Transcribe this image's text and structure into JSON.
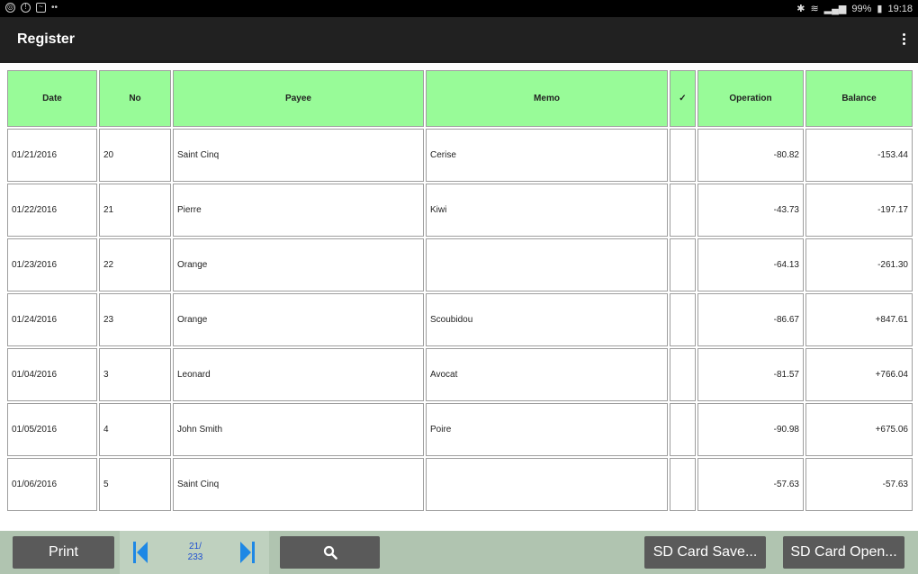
{
  "statusbar": {
    "battery": "99%",
    "time": "19:18"
  },
  "appbar": {
    "title": "Register"
  },
  "table": {
    "headers": [
      "Date",
      "No",
      "Payee",
      "Memo",
      "✓",
      "Operation",
      "Balance"
    ],
    "rows": [
      [
        "01/21/2016",
        "20",
        "Saint Cinq",
        "Cerise",
        "",
        "-80.82",
        "-153.44"
      ],
      [
        "01/22/2016",
        "21",
        "Pierre",
        "Kiwi",
        "",
        "-43.73",
        "-197.17"
      ],
      [
        "01/23/2016",
        "22",
        "Orange",
        "",
        "",
        "-64.13",
        "-261.30"
      ],
      [
        "01/24/2016",
        "23",
        "Orange",
        "Scoubidou",
        "",
        "-86.67",
        "+847.61"
      ],
      [
        "01/04/2016",
        "3",
        "Leonard",
        "Avocat",
        "",
        "-81.57",
        "+766.04"
      ],
      [
        "01/05/2016",
        "4",
        "John Smith",
        "Poire",
        "",
        "-90.98",
        "+675.06"
      ],
      [
        "01/06/2016",
        "5",
        "Saint Cinq",
        "",
        "",
        "-57.63",
        "-57.63"
      ]
    ]
  },
  "bottombar": {
    "print_label": "Print",
    "page_current": "21/",
    "page_total": "233",
    "sd_save_label": "SD Card Save...",
    "sd_open_label": "SD Card Open..."
  },
  "icons": {
    "first": "skip-first-icon",
    "last": "skip-last-icon",
    "search": "search-icon",
    "menu": "overflow-menu-icon"
  },
  "colors": {
    "header_bg": "#98fb98",
    "appbar_bg": "#212121",
    "bottombar_bg": "#b0c4b0",
    "button_bg": "#5a5a5a",
    "nav_blue": "#1e88e5"
  }
}
